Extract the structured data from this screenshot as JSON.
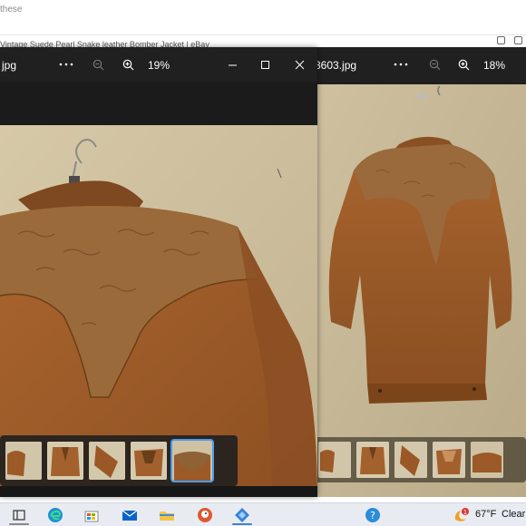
{
  "background_browser": {
    "top_text": "these",
    "tab_text": "Vintage Suede Pearl Snake leather Bomber Jacket | eBay"
  },
  "left_viewer": {
    "filename": "jpg",
    "more_icon": "more-dots-icon",
    "zoom_out_icon": "zoom-out-icon",
    "zoom_in_icon": "zoom-in-icon",
    "zoom": "19%",
    "minimize_icon": "minimize-icon",
    "maximize_icon": "maximize-icon",
    "close_icon": "close-icon",
    "thumbnails": [
      "thumb-1",
      "thumb-2",
      "thumb-3",
      "thumb-4",
      "thumb-5"
    ],
    "selected_thumbnail_index": 4
  },
  "right_viewer": {
    "filename": "3603.jpg",
    "more_icon": "more-dots-icon",
    "zoom_out_icon": "zoom-out-icon",
    "zoom_in_icon": "zoom-in-icon",
    "zoom": "18%",
    "thumbnails": [
      "thumb-1",
      "thumb-2",
      "thumb-3",
      "thumb-4",
      "thumb-5"
    ]
  },
  "taskbar": {
    "apps": [
      "task-view-icon",
      "edge-icon",
      "store-icon",
      "mail-icon",
      "explorer-icon",
      "duckduckgo-icon",
      "paint-icon"
    ],
    "tray_icon": "help-icon",
    "weather_badge": "1",
    "weather_temp": "67°F",
    "weather_condition": "Clear"
  },
  "colors": {
    "window_bg": "#202020",
    "suede": "#9a5a2a",
    "wall": "#cdbf9f",
    "taskbar": "#e8ecf2",
    "accent": "#4a9bf0"
  }
}
